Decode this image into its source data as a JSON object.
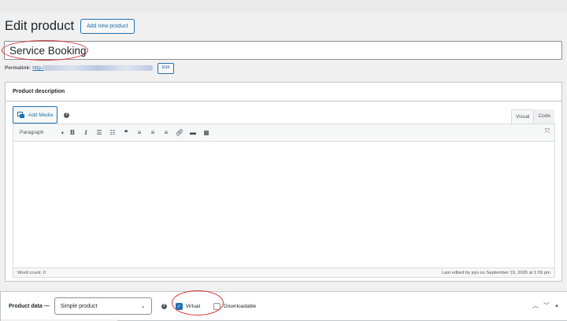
{
  "header": {
    "title": "Edit product",
    "add_new_label": "Add new product"
  },
  "product_title": "Service Booking",
  "permalink": {
    "label": "Permalink:",
    "url_visible": "http:/",
    "edit_label": "Edit"
  },
  "description": {
    "title": "Product description",
    "add_media_label": "Add Media",
    "help_label": "?",
    "tabs": [
      "Visual",
      "Code"
    ],
    "format_select": "Paragraph",
    "toolbar_icons": [
      "bold-icon",
      "italic-icon",
      "bullet-list-icon",
      "numbered-list-icon",
      "blockquote-icon",
      "align-left-icon",
      "align-center-icon",
      "align-right-icon",
      "link-icon",
      "read-more-icon",
      "toolbar-toggle-icon"
    ],
    "word_count": "Word count: 0",
    "last_edited": "Last edited by jojo on September 19, 2026 at 1:09 pm"
  },
  "product_data": {
    "label": "Product data —",
    "type_selected": "Simple product",
    "virtual_label": "Virtual",
    "virtual_checked": true,
    "downloadable_label": "Downloadable",
    "downloadable_checked": false
  },
  "colors": {
    "accent": "#2271b1",
    "highlight_oval": "#d63638"
  }
}
